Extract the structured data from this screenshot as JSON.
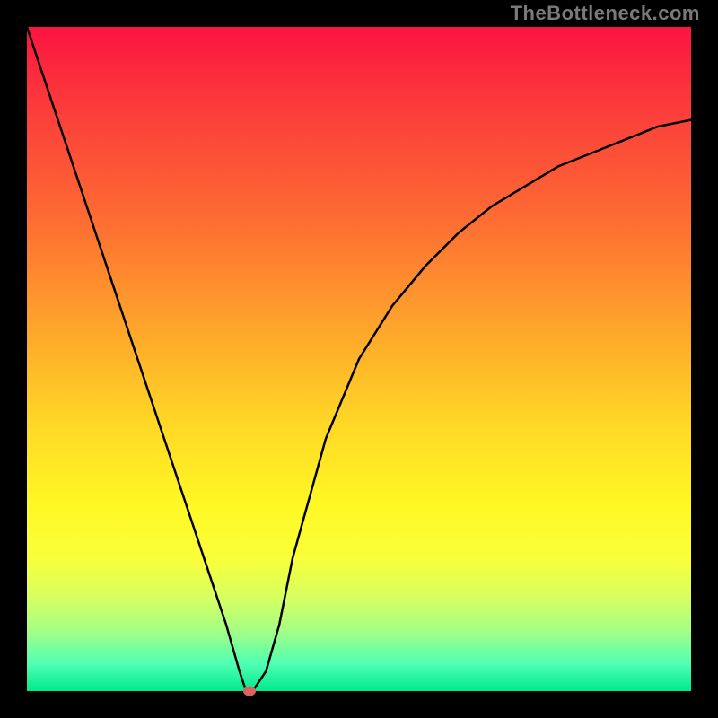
{
  "watermark": "TheBottleneck.com",
  "chart_data": {
    "type": "line",
    "title": "",
    "xlabel": "",
    "ylabel": "",
    "xlim": [
      0,
      100
    ],
    "ylim": [
      0,
      100
    ],
    "grid": false,
    "series": [
      {
        "name": "curve",
        "x": [
          0,
          5,
          10,
          15,
          20,
          25,
          30,
          32,
          33,
          34,
          36,
          38,
          40,
          45,
          50,
          55,
          60,
          65,
          70,
          75,
          80,
          85,
          90,
          95,
          100
        ],
        "y": [
          100,
          85,
          70,
          55,
          40,
          25,
          10,
          3,
          0,
          0,
          3,
          10,
          20,
          38,
          50,
          58,
          64,
          69,
          73,
          76,
          79,
          81,
          83,
          85,
          86
        ]
      }
    ],
    "annotations": [
      {
        "name": "minimum-marker",
        "x": 33.5,
        "y": 0,
        "color": "#d9635f"
      }
    ],
    "background_gradient": {
      "top": "#fb1440",
      "bottom": "#00e98a",
      "stops": [
        "#fb1440",
        "#fc3b3b",
        "#fd6933",
        "#fea42b",
        "#ffd826",
        "#fff824",
        "#faff3a",
        "#d6ff61",
        "#a3ff86",
        "#4dffb4",
        "#00e98a"
      ]
    }
  }
}
